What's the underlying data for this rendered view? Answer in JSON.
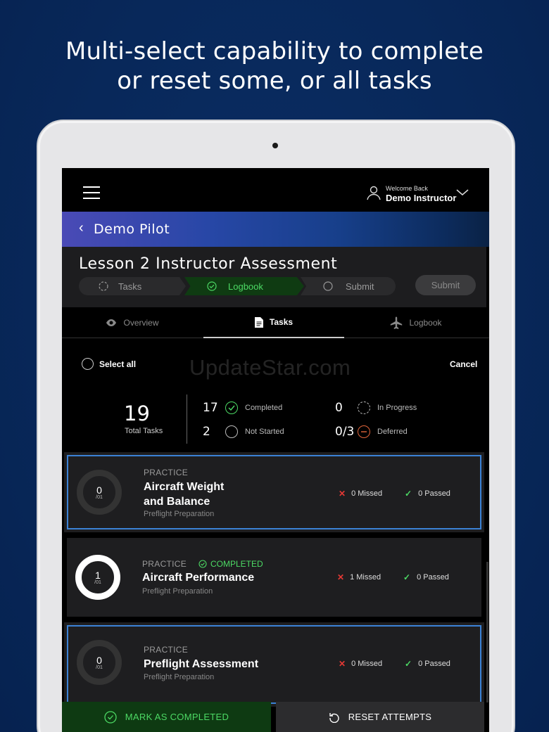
{
  "headline": {
    "line1": "Multi-select capability to complete",
    "line2": "or reset some, or all tasks"
  },
  "header": {
    "welcome_text": "Welcome Back",
    "user_name": "Demo Instructor"
  },
  "pilot_bar": {
    "back_glyph": "‹",
    "pilot_name": "Demo Pilot"
  },
  "lesson": {
    "title": "Lesson 2 Instructor Assessment",
    "steps": [
      {
        "label": "Tasks",
        "state": "pending"
      },
      {
        "label": "Logbook",
        "state": "active"
      },
      {
        "label": "Submit",
        "state": "pending"
      }
    ],
    "submit_label": "Submit"
  },
  "tabs": [
    {
      "label": "Overview",
      "icon": "eye-icon"
    },
    {
      "label": "Tasks",
      "icon": "document-icon",
      "active": true
    },
    {
      "label": "Logbook",
      "icon": "airplane-icon"
    }
  ],
  "selection": {
    "select_all_label": "Select all",
    "cancel_label": "Cancel"
  },
  "watermark": "UpdateStar.com",
  "summary": {
    "total": "19",
    "total_label": "Total Tasks",
    "completed": {
      "value": "17",
      "label": "Completed"
    },
    "in_progress": {
      "value": "0",
      "label": "In Progress"
    },
    "not_started": {
      "value": "2",
      "label": "Not Started"
    },
    "deferred": {
      "value": "0/3",
      "label": "Deferred"
    }
  },
  "tasks": [
    {
      "category": "PRACTICE",
      "title_line1": "Aircraft Weight",
      "title_line2": "and Balance",
      "subtitle": "Preflight Preparation",
      "attempts": "0",
      "attempts_total": "/01",
      "missed": "0 Missed",
      "passed": "0 Passed",
      "selected": true,
      "completed": false
    },
    {
      "category": "PRACTICE",
      "status": "COMPLETED",
      "title_line1": "Aircraft Performance",
      "subtitle": "Preflight Preparation",
      "attempts": "1",
      "attempts_total": "/01",
      "missed": "1 Missed",
      "passed": "0 Passed",
      "selected": false,
      "completed": true
    },
    {
      "category": "PRACTICE",
      "title_line1": "Preflight Assessment",
      "subtitle": "Preflight Preparation",
      "attempts": "0",
      "attempts_total": "/01",
      "missed": "0 Missed",
      "passed": "0 Passed",
      "selected": true,
      "completed": false
    }
  ],
  "actions": {
    "mark_completed": "MARK AS COMPLETED",
    "reset_attempts": "RESET ATTEMPTS"
  },
  "colors": {
    "accent_green": "#4cd964",
    "selection_blue": "#3b82d6",
    "missed_red": "#e53935",
    "deferred_orange": "#e0643a"
  }
}
